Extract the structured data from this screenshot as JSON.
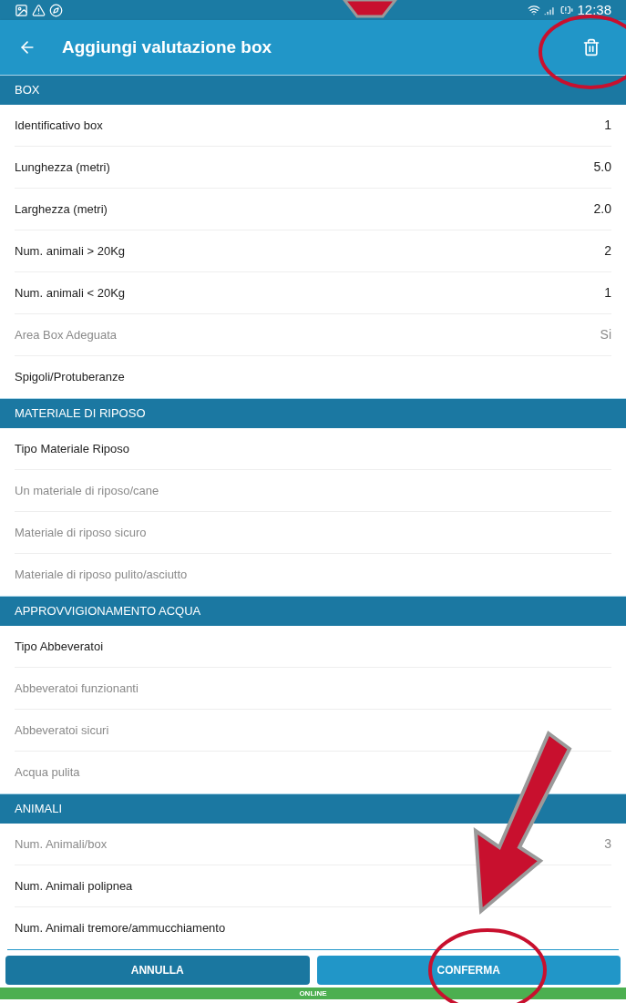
{
  "status_bar": {
    "time": "12:38"
  },
  "toolbar": {
    "title": "Aggiungi valutazione box"
  },
  "sections": [
    {
      "title": "BOX",
      "rows": [
        {
          "label": "Identificativo box",
          "value": "1",
          "disabled": false
        },
        {
          "label": "Lunghezza (metri)",
          "value": "5.0",
          "disabled": false
        },
        {
          "label": "Larghezza (metri)",
          "value": "2.0",
          "disabled": false
        },
        {
          "label": "Num. animali > 20Kg",
          "value": "2",
          "disabled": false
        },
        {
          "label": "Num. animali < 20Kg",
          "value": "1",
          "disabled": false
        },
        {
          "label": "Area Box Adeguata",
          "value": "Si",
          "disabled": true
        },
        {
          "label": "Spigoli/Protuberanze",
          "disabled": false
        }
      ]
    },
    {
      "title": "MATERIALE DI RIPOSO",
      "rows": [
        {
          "label": "Tipo Materiale Riposo",
          "disabled": false
        },
        {
          "label": "Un materiale di riposo/cane",
          "disabled": true
        },
        {
          "label": "Materiale di riposo sicuro",
          "disabled": true
        },
        {
          "label": "Materiale di riposo pulito/asciutto",
          "disabled": true
        }
      ]
    },
    {
      "title": "APPROVVIGIONAMENTO ACQUA",
      "rows": [
        {
          "label": "Tipo Abbeveratoi",
          "disabled": false
        },
        {
          "label": "Abbeveratoi funzionanti",
          "disabled": true
        },
        {
          "label": "Abbeveratoi sicuri",
          "disabled": true
        },
        {
          "label": "Acqua pulita",
          "disabled": true
        }
      ]
    },
    {
      "title": "ANIMALI",
      "rows": [
        {
          "label": "Num. Animali/box",
          "value": "3",
          "disabled": true
        },
        {
          "label": "Num. Animali polipnea",
          "disabled": false
        },
        {
          "label": "Num. Animali tremore/ammucchiamento",
          "disabled": false
        }
      ]
    }
  ],
  "buttons": [
    {
      "label": "ANNULLA",
      "kind": "secondary"
    },
    {
      "label": "CONFERMA",
      "kind": "primary"
    }
  ],
  "connection": {
    "label": "ONLINE"
  }
}
